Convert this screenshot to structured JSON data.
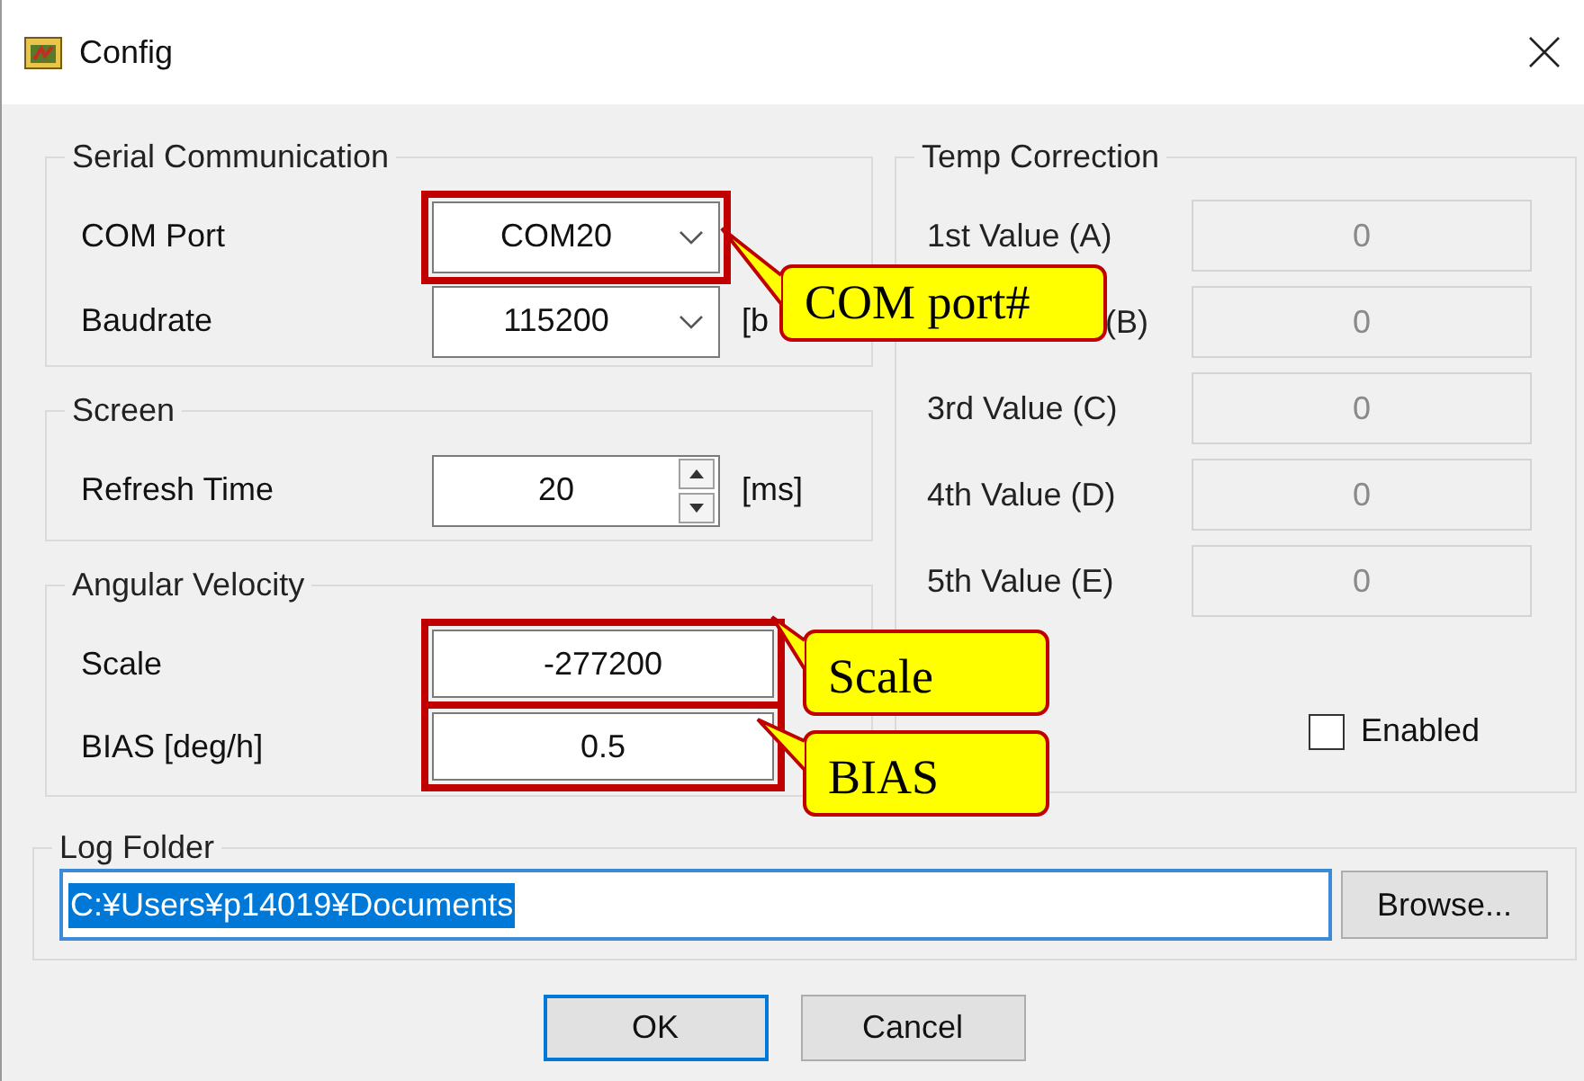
{
  "window": {
    "title": "Config"
  },
  "serial": {
    "title": "Serial Communication",
    "rows": [
      {
        "kind": "combo",
        "label": "COM Port",
        "value": "COM20",
        "highlighted": true
      },
      {
        "kind": "combo",
        "label": "Baudrate",
        "value": "115200",
        "unit": "[b",
        "highlighted": false
      }
    ]
  },
  "screen": {
    "title": "Screen",
    "rows": [
      {
        "kind": "spin",
        "label": "Refresh Time",
        "value": "20",
        "unit": "[ms]",
        "highlighted": false
      }
    ]
  },
  "angular": {
    "title": "Angular Velocity",
    "rows": [
      {
        "kind": "text",
        "label": "Scale",
        "value": "-277200",
        "highlighted": true
      },
      {
        "kind": "text",
        "label": "BIAS [deg/h]",
        "value": "0.5",
        "highlighted": true
      }
    ]
  },
  "temp": {
    "title": "Temp Correction",
    "rows": [
      {
        "label": "1st Value (A)",
        "value": "0",
        "disabled": true
      },
      {
        "label": "(B)",
        "value": "0",
        "disabled": true
      },
      {
        "label": "3rd Value (C)",
        "value": "0",
        "disabled": true
      },
      {
        "label": "4th Value (D)",
        "value": "0",
        "disabled": true
      },
      {
        "label": "5th Value (E)",
        "value": "0",
        "disabled": true
      }
    ],
    "enabled": {
      "label": "Enabled",
      "checked": false
    }
  },
  "log": {
    "title": "Log Folder",
    "value": "C:¥Users¥p14019¥Documents",
    "selected": true,
    "browse": "Browse..."
  },
  "buttons": [
    {
      "label": "OK",
      "default": true
    },
    {
      "label": "Cancel",
      "default": false
    }
  ],
  "callouts": [
    {
      "text": "COM port#"
    },
    {
      "text": "Scale"
    },
    {
      "text": "BIAS"
    }
  ]
}
